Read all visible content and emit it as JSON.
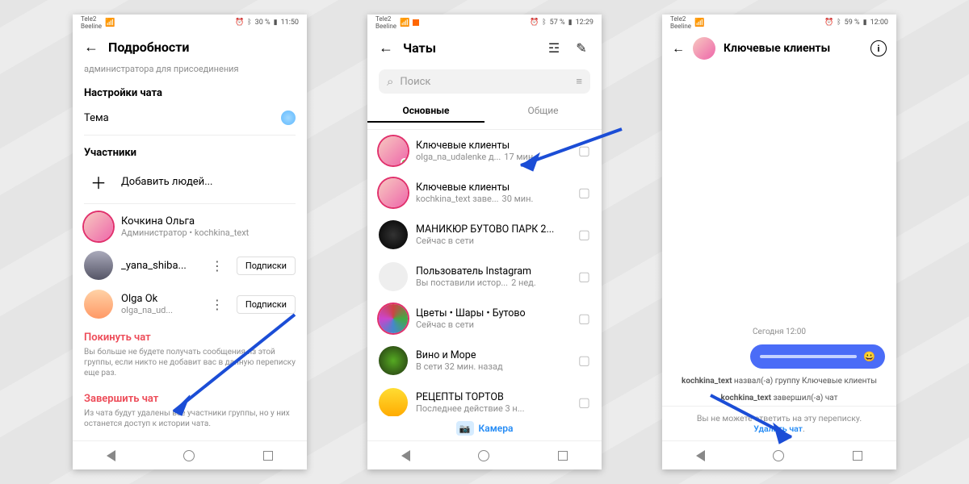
{
  "status1": {
    "carrier1": "Tele2",
    "carrier2": "Beeline",
    "bt": "30 %",
    "time": "11:50"
  },
  "status2": {
    "carrier1": "Tele2",
    "carrier2": "Beeline",
    "bt": "57 %",
    "time": "12:29"
  },
  "status3": {
    "carrier1": "Tele2",
    "carrier2": "Beeline",
    "bt": "59 %",
    "time": "12:00"
  },
  "screen1": {
    "header": "Подробности",
    "admin_note": "администратора для присоединения",
    "sec_settings": "Настройки чата",
    "theme_label": "Тема",
    "sec_members": "Участники",
    "add_people": "Добавить людей...",
    "members": [
      {
        "name": "Кочкина Ольга",
        "sub": "Администратор • kochkina_text"
      },
      {
        "name": "_yana_shiba...",
        "sub": ""
      },
      {
        "name": "Olga Ok",
        "sub": "olga_na_ud..."
      }
    ],
    "subscribe": "Подписки",
    "leave": "Покинуть чат",
    "leave_help": "Вы больше не будете получать сообщения из этой группы, если никто не добавит вас в данную переписку еще раз.",
    "end": "Завершить чат",
    "end_help": "Из чата будут удалены все участники группы, но у них останется доступ к истории чата."
  },
  "screen2": {
    "header": "Чаты",
    "search_placeholder": "Поиск",
    "tabs": {
      "main": "Основные",
      "general": "Общие"
    },
    "chats": [
      {
        "name": "Ключевые клиенты",
        "sub": "olga_na_udalenke д...",
        "time": "17 мин.",
        "online": true
      },
      {
        "name": "Ключевые клиенты",
        "sub": "kochkina_text заве...",
        "time": "30 мин."
      },
      {
        "name": "МАНИКЮР БУТОВО ПАРК 2...",
        "sub": "Сейчас в сети",
        "time": ""
      },
      {
        "name": "Пользователь Instagram",
        "sub": "Вы поставили истор...",
        "time": "2 нед."
      },
      {
        "name": "Цветы • Шары • Бутово",
        "sub": "Сейчас в сети",
        "time": ""
      },
      {
        "name": "Вино и Море",
        "sub": "В сети 32 мин. назад",
        "time": ""
      },
      {
        "name": "РЕЦЕПТЫ ТОРТОВ",
        "sub": "Последнее действие 3 н...",
        "time": ""
      }
    ],
    "camera": "Камера"
  },
  "screen3": {
    "header": "Ключевые клиенты",
    "timestamp": "Сегодня 12:00",
    "sys1_user": "kochkina_text",
    "sys1_rest": " назвал(-а) группу Ключевые клиенты",
    "sys2_user": "kochkina_text",
    "sys2_rest": " завершил(-а) чат",
    "foot": "Вы не можете ответить на эту переписку.",
    "delete": "Удалить чат"
  }
}
